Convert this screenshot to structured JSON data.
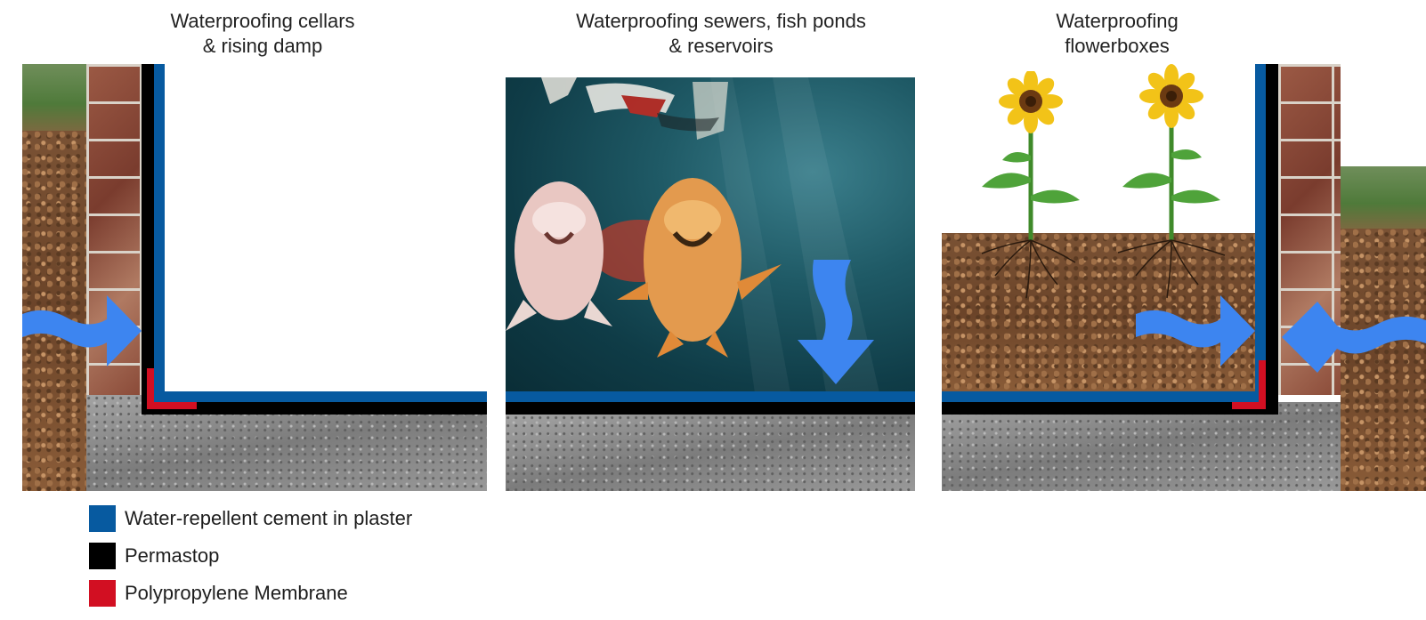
{
  "titles": {
    "cellars": "Waterproofing cellars\n& rising damp",
    "ponds": "Waterproofing sewers, fish ponds\n& reservoirs",
    "flowerboxes": "Waterproofing\nflowerboxes"
  },
  "legend": [
    {
      "label": "Water-repellent cement in plaster",
      "color": "#075aa0"
    },
    {
      "label": "Permastop",
      "color": "#000000"
    },
    {
      "label": "Polypropylene Membrane",
      "color": "#d20f22"
    }
  ],
  "colors": {
    "water_arrow": "#3d85f0",
    "water_repellent_cement": "#075aa0",
    "permastop": "#000000",
    "polypropylene_membrane": "#d20f22"
  },
  "icons": [
    "water-flow-arrow-icon",
    "sunflower-icon",
    "koi-fish-icon"
  ]
}
